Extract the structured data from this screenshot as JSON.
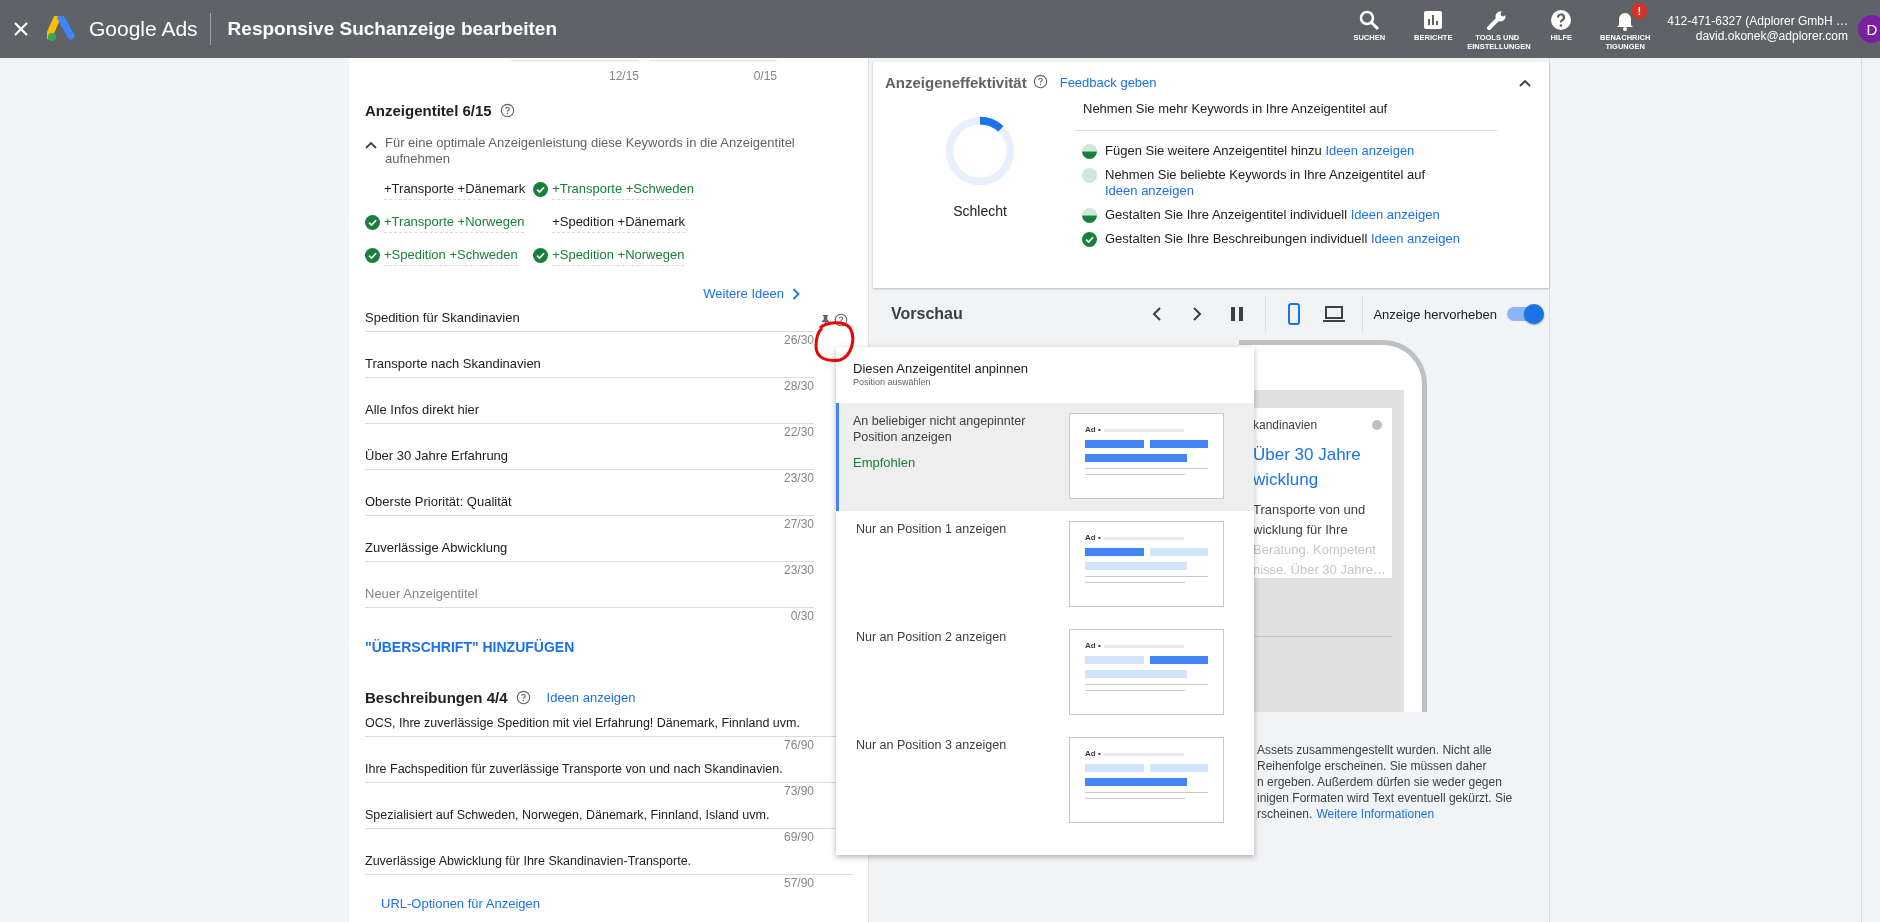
{
  "top_bar": {
    "product": "Google Ads",
    "title": "Responsive Suchanzeige bearbeiten",
    "nav": [
      {
        "kind": "search",
        "label": "SUCHEN"
      },
      {
        "kind": "reports",
        "label": "BERICHTE"
      },
      {
        "kind": "tools",
        "label": "TOOLS UND EINSTELLUNGEN"
      },
      {
        "kind": "help",
        "label": "HILFE"
      },
      {
        "kind": "notifications",
        "label": "BENACHRICHTIGUNGEN",
        "badge": "!"
      }
    ],
    "account": {
      "name": "412-471-6327 (Adplorer GmbH …",
      "email": "david.okonek@adplorer.com",
      "avatar": "D"
    }
  },
  "editor": {
    "top_counters": [
      "12/15",
      "0/15"
    ],
    "headlines": {
      "title": "Anzeigentitel 6/15",
      "keyword_hint": {
        "expanded": true,
        "text": "Für eine optimale Anzeigenleistung diese Keywords in die Anzeigentitel aufnehmen"
      },
      "keywords": [
        {
          "text": "+Transporte +Dänemark",
          "used": false
        },
        {
          "text": "+Transporte +Schweden",
          "used": true
        },
        {
          "text": "+Transporte +Norwegen",
          "used": true
        },
        {
          "text": "+Spedition +Dänemark",
          "used": false
        },
        {
          "text": "+Spedition +Schweden",
          "used": true
        },
        {
          "text": "+Spedition +Norwegen",
          "used": true
        }
      ],
      "more_ideas": "Weitere Ideen",
      "items": [
        {
          "text": "Spedition für Skandinavien",
          "count": "26/30",
          "focused": true
        },
        {
          "text": "Transporte nach Skandinavien",
          "count": "28/30",
          "focused": false
        },
        {
          "text": "Alle Infos direkt hier",
          "count": "22/30",
          "focused": false
        },
        {
          "text": "Über 30 Jahre Erfahrung",
          "count": "23/30",
          "focused": false
        },
        {
          "text": "Oberste Priorität: Qualität",
          "count": "27/30",
          "focused": false
        },
        {
          "text": "Zuverlässige Abwicklung",
          "count": "23/30",
          "focused": false
        },
        {
          "placeholder": "Neuer Anzeigentitel",
          "count": "0/30",
          "focused": false
        }
      ],
      "add_button": "\"ÜBERSCHRIFT\" HINZUFÜGEN"
    },
    "descriptions": {
      "title": "Beschreibungen 4/4",
      "ideas_link": "Ideen anzeigen",
      "items": [
        {
          "text": "OCS, Ihre zuverlässige Spedition mit viel Erfahrung! Dänemark, Finnland uvm.",
          "count": "76/90"
        },
        {
          "text": "Ihre Fachspedition für zuverlässige Transporte von und nach Skandinavien.",
          "count": "73/90"
        },
        {
          "text": "Spezialisiert auf Schweden, Norwegen, Dänemark, Finnland, Island uvm.",
          "count": "69/90"
        },
        {
          "text": "Zuverlässige Abwicklung für Ihre Skandinavien-Transporte.",
          "count": "57/90"
        }
      ]
    },
    "url_options": "URL-Optionen für Anzeigen"
  },
  "effectiveness": {
    "title": "Anzeigeneffektivität",
    "feedback": "Feedback geben",
    "rating": "Schlecht",
    "level": 0.12,
    "tip": "Nehmen Sie mehr Keywords in Ihre Anzeigentitel auf",
    "checks": [
      {
        "kind": "partial",
        "text": "Fügen Sie weitere Anzeigentitel hinzu",
        "link": "Ideen anzeigen"
      },
      {
        "kind": "open",
        "text": "Nehmen Sie beliebte Keywords in Ihre Anzeigentitel auf",
        "link": "Ideen anzeigen"
      },
      {
        "kind": "partial",
        "text": "Gestalten Sie Ihre Anzeigentitel individuell",
        "link": "Ideen anzeigen"
      },
      {
        "kind": "done",
        "text": "Gestalten Sie Ihre Beschreibungen individuell",
        "link": "Ideen anzeigen"
      }
    ]
  },
  "preview": {
    "title": "Vorschau",
    "devices": [
      {
        "kind": "phone",
        "selected": true
      },
      {
        "kind": "laptop",
        "selected": false
      }
    ],
    "highlight": {
      "label": "Anzeige hervorheben",
      "on": true
    },
    "ad": {
      "url": "kandinavien",
      "headline": [
        "Über 30 Jahre",
        "wicklung"
      ],
      "description": [
        "Transporte von und",
        "wicklung für Ihre"
      ],
      "faded": [
        "Beratung. Kompetent",
        "nisse. Über 30 Jahre…"
      ]
    },
    "note": {
      "lines": [
        "Assets zusammengestellt wurden. Nicht alle",
        "Reihenfolge erscheinen. Sie müssen daher",
        "n ergeben. Außerdem dürfen sie weder gegen",
        "inigen Formaten wird Text eventuell gekürzt. Sie",
        "rscheinen."
      ],
      "link": "Weitere Informationen"
    }
  },
  "pin_menu": {
    "title": "Diesen Anzeigentitel anpinnen",
    "subtitle": "Position auswählen",
    "options": [
      {
        "label": "An beliebiger nicht angepinnter Position anzeigen",
        "note": "Empfohlen",
        "selected": true,
        "ad_label": "Ad •",
        "bars": [
          {
            "filled": true
          },
          {
            "filled": true
          },
          {
            "filled": true
          }
        ]
      },
      {
        "label": "Nur an Position 1 anzeigen",
        "selected": false,
        "ad_label": "Ad •",
        "bars": [
          {
            "filled": true
          },
          {
            "filled": false
          },
          {
            "filled": false
          }
        ]
      },
      {
        "label": "Nur an Position 2 anzeigen",
        "selected": false,
        "ad_label": "Ad •",
        "bars": [
          {
            "filled": false
          },
          {
            "filled": true
          },
          {
            "filled": false
          }
        ]
      },
      {
        "label": "Nur an Position 3 anzeigen",
        "selected": false,
        "ad_label": "Ad •",
        "bars": [
          {
            "filled": false
          },
          {
            "filled": false
          },
          {
            "filled": true
          }
        ]
      }
    ]
  }
}
